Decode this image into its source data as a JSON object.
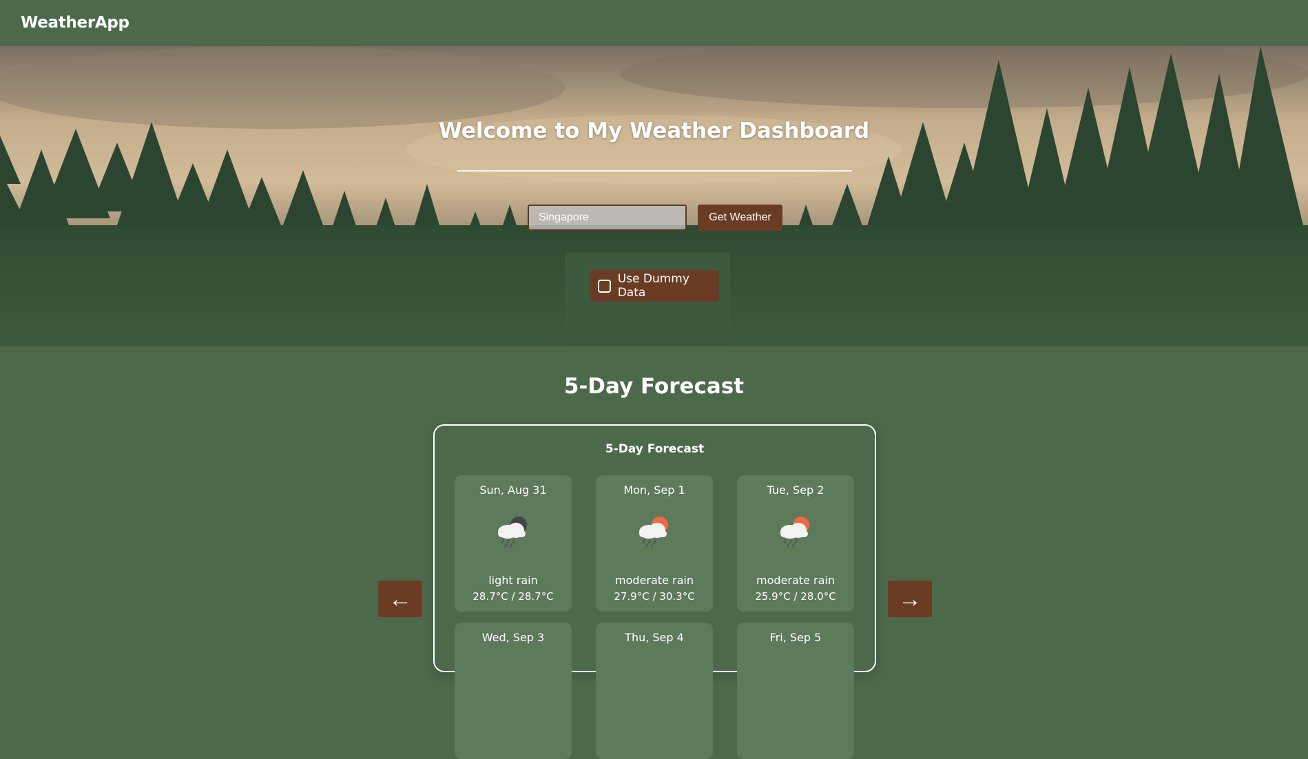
{
  "navbar": {
    "brand": "WeatherApp"
  },
  "hero": {
    "title": "Welcome to My Weather Dashboard",
    "search": {
      "value": "Singapore",
      "placeholder": ""
    },
    "get_weather_label": "Get Weather",
    "dummy_data_label": "Use Dummy Data",
    "dummy_data_checked": false
  },
  "forecast": {
    "section_title": "5-Day Forecast",
    "card_title": "5-Day Forecast",
    "prev_label": "←",
    "next_label": "→",
    "days": [
      {
        "date": "Sun, Aug 31",
        "icon": "night-rain-cloud-icon",
        "desc": "light rain",
        "temp": "28.7°C / 28.7°C"
      },
      {
        "date": "Mon, Sep 1",
        "icon": "sun-rain-cloud-icon",
        "desc": "moderate rain",
        "temp": "27.9°C / 30.3°C"
      },
      {
        "date": "Tue, Sep 2",
        "icon": "sun-rain-cloud-icon",
        "desc": "moderate rain",
        "temp": "25.9°C / 28.0°C"
      },
      {
        "date": "Wed, Sep 3"
      },
      {
        "date": "Thu, Sep 4"
      },
      {
        "date": "Fri, Sep 5"
      }
    ]
  },
  "colors": {
    "background": "#4c6a4a",
    "accent_brown": "#6a3c24",
    "day_card": "#5d7a5b",
    "sun": "#ee6a45",
    "moon": "#444444"
  }
}
